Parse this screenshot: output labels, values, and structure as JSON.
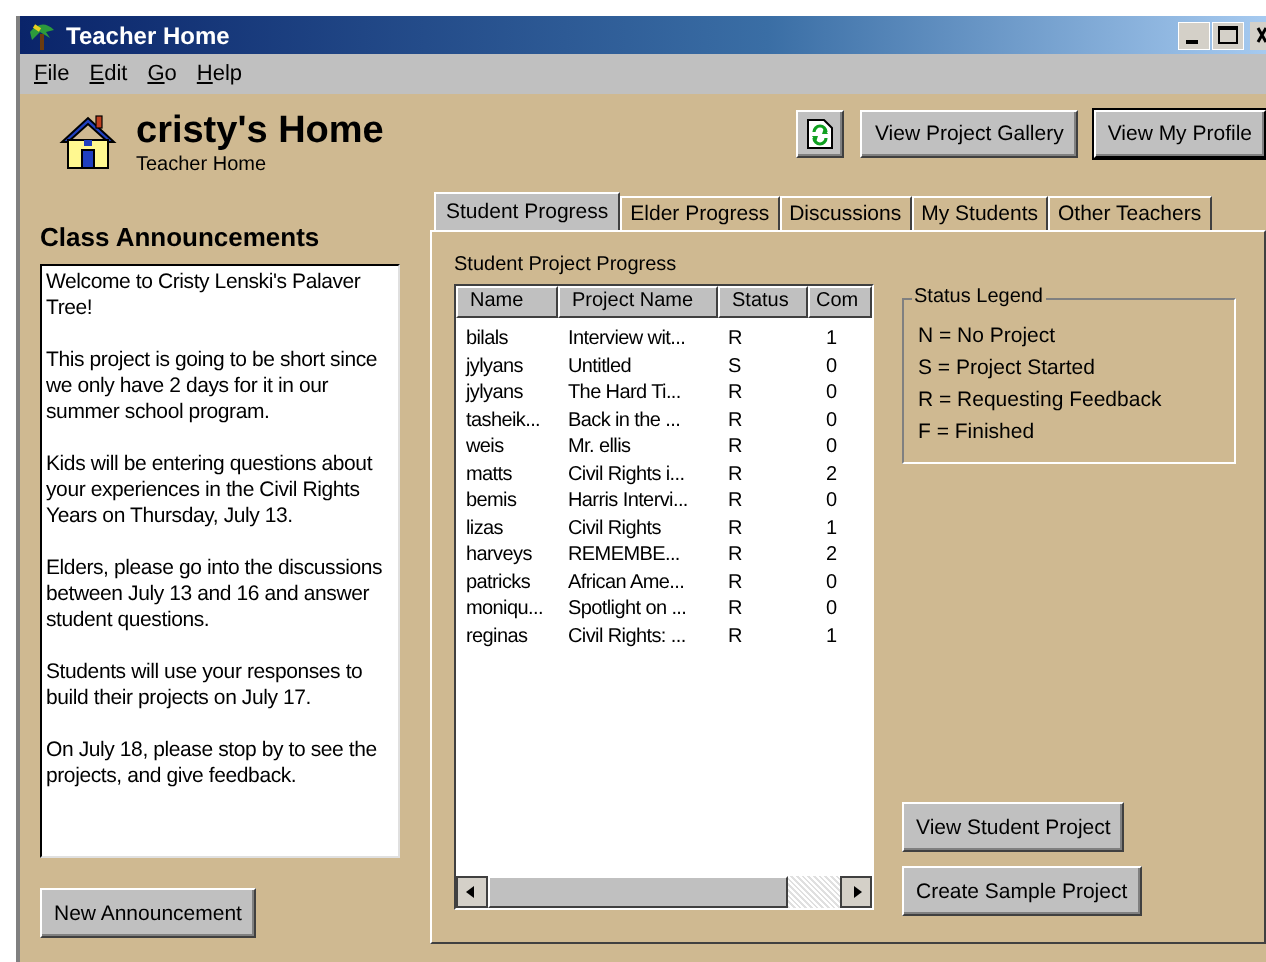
{
  "window": {
    "title": "Teacher Home"
  },
  "menu": [
    {
      "label": "File"
    },
    {
      "label": "Edit"
    },
    {
      "label": "Go"
    },
    {
      "label": "Help"
    }
  ],
  "header": {
    "title": "cristy's Home",
    "subtitle": "Teacher Home"
  },
  "toolbar": [
    {
      "kind": "icon",
      "focused": false
    },
    {
      "kind": "text",
      "label": "View Project Gallery",
      "focused": false
    },
    {
      "kind": "text",
      "label": "View My Profile",
      "focused": true
    }
  ],
  "announcements": {
    "title": "Class Announcements",
    "paragraphs": [
      "Welcome to Cristy Lenski's Palaver Tree!",
      "This project is going to be short since we only have 2 days for it in our summer school program.",
      "Kids will be entering questions about your experiences in the Civil Rights Years on Thursday, July 13.",
      "Elders, please go into the discussions between July 13 and 16 and answer student questions.",
      "Students will use your responses to build their projects on July 17.",
      "On July 18, please stop by to see the projects, and give feedback."
    ],
    "button": "New Announcement"
  },
  "tabs": [
    {
      "label": "Student Progress",
      "selected": true
    },
    {
      "label": "Elder Progress",
      "selected": false
    },
    {
      "label": "Discussions",
      "selected": false
    },
    {
      "label": "My Students",
      "selected": false
    },
    {
      "label": "Other Teachers",
      "selected": false
    }
  ],
  "progress": {
    "title": "Student Project Progress",
    "columns": [
      "Name",
      "Project Name",
      "Status",
      "Com"
    ],
    "rows": [
      [
        "bilals",
        "Interview wit...",
        "R",
        "1"
      ],
      [
        "jylyans",
        "Untitled",
        "S",
        "0"
      ],
      [
        "jylyans",
        "The Hard Ti...",
        "R",
        "0"
      ],
      [
        "tasheik...",
        "Back in the ...",
        "R",
        "0"
      ],
      [
        "weis",
        "Mr. ellis",
        "R",
        "0"
      ],
      [
        "matts",
        "Civil Rights i...",
        "R",
        "2"
      ],
      [
        "bemis",
        "Harris Intervi...",
        "R",
        "0"
      ],
      [
        "lizas",
        "Civil Rights",
        "R",
        "1"
      ],
      [
        "harveys",
        "REMEMBE...",
        "R",
        "2"
      ],
      [
        "patricks",
        "African Ame...",
        "R",
        "0"
      ],
      [
        "moniqu...",
        "Spotlight on ...",
        "R",
        "0"
      ],
      [
        "reginas",
        "Civil Rights: ...",
        "R",
        "1"
      ]
    ],
    "legend": {
      "title": "Status Legend",
      "items": [
        "N = No Project",
        "S = Project Started",
        "R = Requesting Feedback",
        "F = Finished"
      ]
    },
    "buttons": [
      "View Student Project",
      "Create Sample Project"
    ]
  }
}
